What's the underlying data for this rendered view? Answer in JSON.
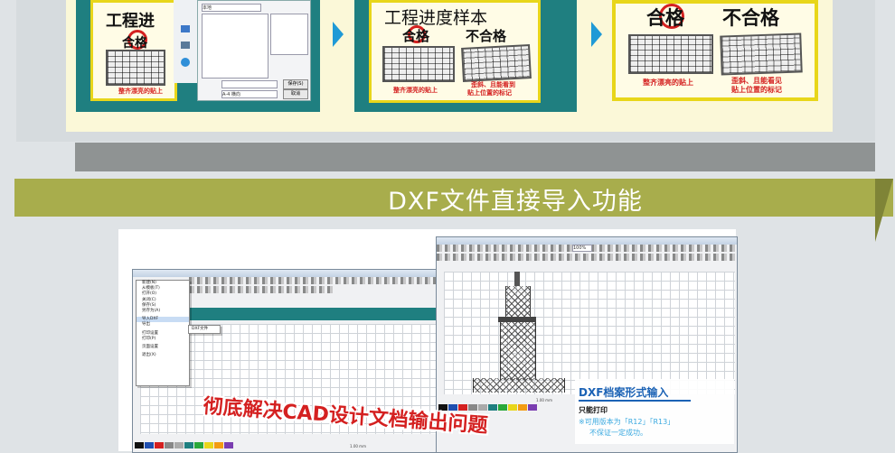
{
  "top": {
    "panel1": {
      "sign_title": "工程进",
      "pass": "合格",
      "caption": "整齐漂亮的贴上",
      "side_icons_labels": [
        "",
        "",
        ""
      ],
      "dialog": {
        "fields": [
          "本地",
          "",
          "A-4 横向"
        ],
        "buttons": [
          "保存(S)",
          "取消"
        ]
      }
    },
    "panel2": {
      "sign_title": "工程进度样本",
      "pass": "合格",
      "fail": "不合格",
      "caption_left": "整齐漂亮的贴上",
      "caption_right_1": "歪斜、且能看到",
      "caption_right_2": "贴上位置的标记"
    },
    "panel3": {
      "pass": "合格",
      "fail": "不合格",
      "caption_left": "整齐漂亮的贴上",
      "caption_right_1": "歪斜、且能看见",
      "caption_right_2": "贴上位置的标记"
    }
  },
  "section": {
    "title": "DXF文件直接导入功能"
  },
  "bottom": {
    "left_window": {
      "menu_items": [
        "新建(N)",
        "从模板(T)",
        "打开(O)",
        "关闭(C)",
        "保存(S)",
        "另存为(A)",
        "",
        "导入DXF",
        "导出",
        "",
        "打印设置",
        "打印(P)",
        "",
        "页面设置",
        "",
        "退出(X)"
      ],
      "submenu_item": "DXF文件",
      "status": "1.00 mm"
    },
    "right_window": {
      "zoom": "100%",
      "status": "1.00 mm"
    },
    "headline": "彻底解决CAD设计文档输出问题",
    "dxf_box": {
      "title": "DXF档案形式输入",
      "subtitle": "只能打印",
      "note_1": "※可用版本为「R12」「R13」",
      "note_2": "不保证一定成功。"
    },
    "palette": [
      "#111111",
      "#1f4fb0",
      "#d42020",
      "#888888",
      "#aaaaaa",
      "#1f7f80",
      "#2aa83a",
      "#e8d61a",
      "#f39c12",
      "#7a3db0"
    ]
  }
}
